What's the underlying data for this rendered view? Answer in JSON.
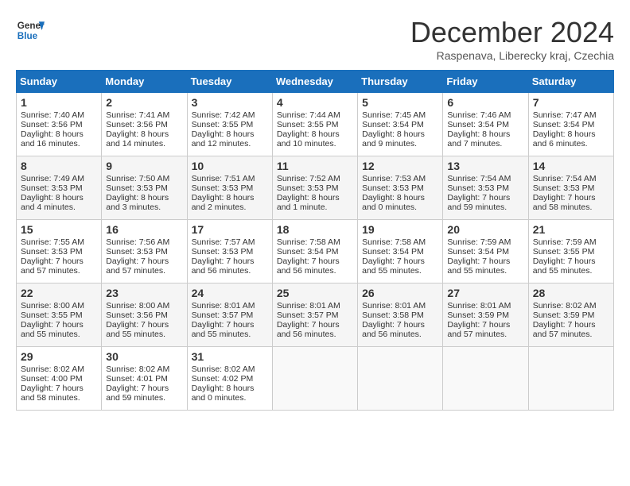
{
  "header": {
    "logo_line1": "General",
    "logo_line2": "Blue",
    "month_title": "December 2024",
    "subtitle": "Raspenava, Liberecky kraj, Czechia"
  },
  "days_of_week": [
    "Sunday",
    "Monday",
    "Tuesday",
    "Wednesday",
    "Thursday",
    "Friday",
    "Saturday"
  ],
  "weeks": [
    [
      {
        "day": "1",
        "sunrise": "Sunrise: 7:40 AM",
        "sunset": "Sunset: 3:56 PM",
        "daylight": "Daylight: 8 hours and 16 minutes."
      },
      {
        "day": "2",
        "sunrise": "Sunrise: 7:41 AM",
        "sunset": "Sunset: 3:56 PM",
        "daylight": "Daylight: 8 hours and 14 minutes."
      },
      {
        "day": "3",
        "sunrise": "Sunrise: 7:42 AM",
        "sunset": "Sunset: 3:55 PM",
        "daylight": "Daylight: 8 hours and 12 minutes."
      },
      {
        "day": "4",
        "sunrise": "Sunrise: 7:44 AM",
        "sunset": "Sunset: 3:55 PM",
        "daylight": "Daylight: 8 hours and 10 minutes."
      },
      {
        "day": "5",
        "sunrise": "Sunrise: 7:45 AM",
        "sunset": "Sunset: 3:54 PM",
        "daylight": "Daylight: 8 hours and 9 minutes."
      },
      {
        "day": "6",
        "sunrise": "Sunrise: 7:46 AM",
        "sunset": "Sunset: 3:54 PM",
        "daylight": "Daylight: 8 hours and 7 minutes."
      },
      {
        "day": "7",
        "sunrise": "Sunrise: 7:47 AM",
        "sunset": "Sunset: 3:54 PM",
        "daylight": "Daylight: 8 hours and 6 minutes."
      }
    ],
    [
      {
        "day": "8",
        "sunrise": "Sunrise: 7:49 AM",
        "sunset": "Sunset: 3:53 PM",
        "daylight": "Daylight: 8 hours and 4 minutes."
      },
      {
        "day": "9",
        "sunrise": "Sunrise: 7:50 AM",
        "sunset": "Sunset: 3:53 PM",
        "daylight": "Daylight: 8 hours and 3 minutes."
      },
      {
        "day": "10",
        "sunrise": "Sunrise: 7:51 AM",
        "sunset": "Sunset: 3:53 PM",
        "daylight": "Daylight: 8 hours and 2 minutes."
      },
      {
        "day": "11",
        "sunrise": "Sunrise: 7:52 AM",
        "sunset": "Sunset: 3:53 PM",
        "daylight": "Daylight: 8 hours and 1 minute."
      },
      {
        "day": "12",
        "sunrise": "Sunrise: 7:53 AM",
        "sunset": "Sunset: 3:53 PM",
        "daylight": "Daylight: 8 hours and 0 minutes."
      },
      {
        "day": "13",
        "sunrise": "Sunrise: 7:54 AM",
        "sunset": "Sunset: 3:53 PM",
        "daylight": "Daylight: 7 hours and 59 minutes."
      },
      {
        "day": "14",
        "sunrise": "Sunrise: 7:54 AM",
        "sunset": "Sunset: 3:53 PM",
        "daylight": "Daylight: 7 hours and 58 minutes."
      }
    ],
    [
      {
        "day": "15",
        "sunrise": "Sunrise: 7:55 AM",
        "sunset": "Sunset: 3:53 PM",
        "daylight": "Daylight: 7 hours and 57 minutes."
      },
      {
        "day": "16",
        "sunrise": "Sunrise: 7:56 AM",
        "sunset": "Sunset: 3:53 PM",
        "daylight": "Daylight: 7 hours and 57 minutes."
      },
      {
        "day": "17",
        "sunrise": "Sunrise: 7:57 AM",
        "sunset": "Sunset: 3:53 PM",
        "daylight": "Daylight: 7 hours and 56 minutes."
      },
      {
        "day": "18",
        "sunrise": "Sunrise: 7:58 AM",
        "sunset": "Sunset: 3:54 PM",
        "daylight": "Daylight: 7 hours and 56 minutes."
      },
      {
        "day": "19",
        "sunrise": "Sunrise: 7:58 AM",
        "sunset": "Sunset: 3:54 PM",
        "daylight": "Daylight: 7 hours and 55 minutes."
      },
      {
        "day": "20",
        "sunrise": "Sunrise: 7:59 AM",
        "sunset": "Sunset: 3:54 PM",
        "daylight": "Daylight: 7 hours and 55 minutes."
      },
      {
        "day": "21",
        "sunrise": "Sunrise: 7:59 AM",
        "sunset": "Sunset: 3:55 PM",
        "daylight": "Daylight: 7 hours and 55 minutes."
      }
    ],
    [
      {
        "day": "22",
        "sunrise": "Sunrise: 8:00 AM",
        "sunset": "Sunset: 3:55 PM",
        "daylight": "Daylight: 7 hours and 55 minutes."
      },
      {
        "day": "23",
        "sunrise": "Sunrise: 8:00 AM",
        "sunset": "Sunset: 3:56 PM",
        "daylight": "Daylight: 7 hours and 55 minutes."
      },
      {
        "day": "24",
        "sunrise": "Sunrise: 8:01 AM",
        "sunset": "Sunset: 3:57 PM",
        "daylight": "Daylight: 7 hours and 55 minutes."
      },
      {
        "day": "25",
        "sunrise": "Sunrise: 8:01 AM",
        "sunset": "Sunset: 3:57 PM",
        "daylight": "Daylight: 7 hours and 56 minutes."
      },
      {
        "day": "26",
        "sunrise": "Sunrise: 8:01 AM",
        "sunset": "Sunset: 3:58 PM",
        "daylight": "Daylight: 7 hours and 56 minutes."
      },
      {
        "day": "27",
        "sunrise": "Sunrise: 8:01 AM",
        "sunset": "Sunset: 3:59 PM",
        "daylight": "Daylight: 7 hours and 57 minutes."
      },
      {
        "day": "28",
        "sunrise": "Sunrise: 8:02 AM",
        "sunset": "Sunset: 3:59 PM",
        "daylight": "Daylight: 7 hours and 57 minutes."
      }
    ],
    [
      {
        "day": "29",
        "sunrise": "Sunrise: 8:02 AM",
        "sunset": "Sunset: 4:00 PM",
        "daylight": "Daylight: 7 hours and 58 minutes."
      },
      {
        "day": "30",
        "sunrise": "Sunrise: 8:02 AM",
        "sunset": "Sunset: 4:01 PM",
        "daylight": "Daylight: 7 hours and 59 minutes."
      },
      {
        "day": "31",
        "sunrise": "Sunrise: 8:02 AM",
        "sunset": "Sunset: 4:02 PM",
        "daylight": "Daylight: 8 hours and 0 minutes."
      },
      null,
      null,
      null,
      null
    ]
  ]
}
